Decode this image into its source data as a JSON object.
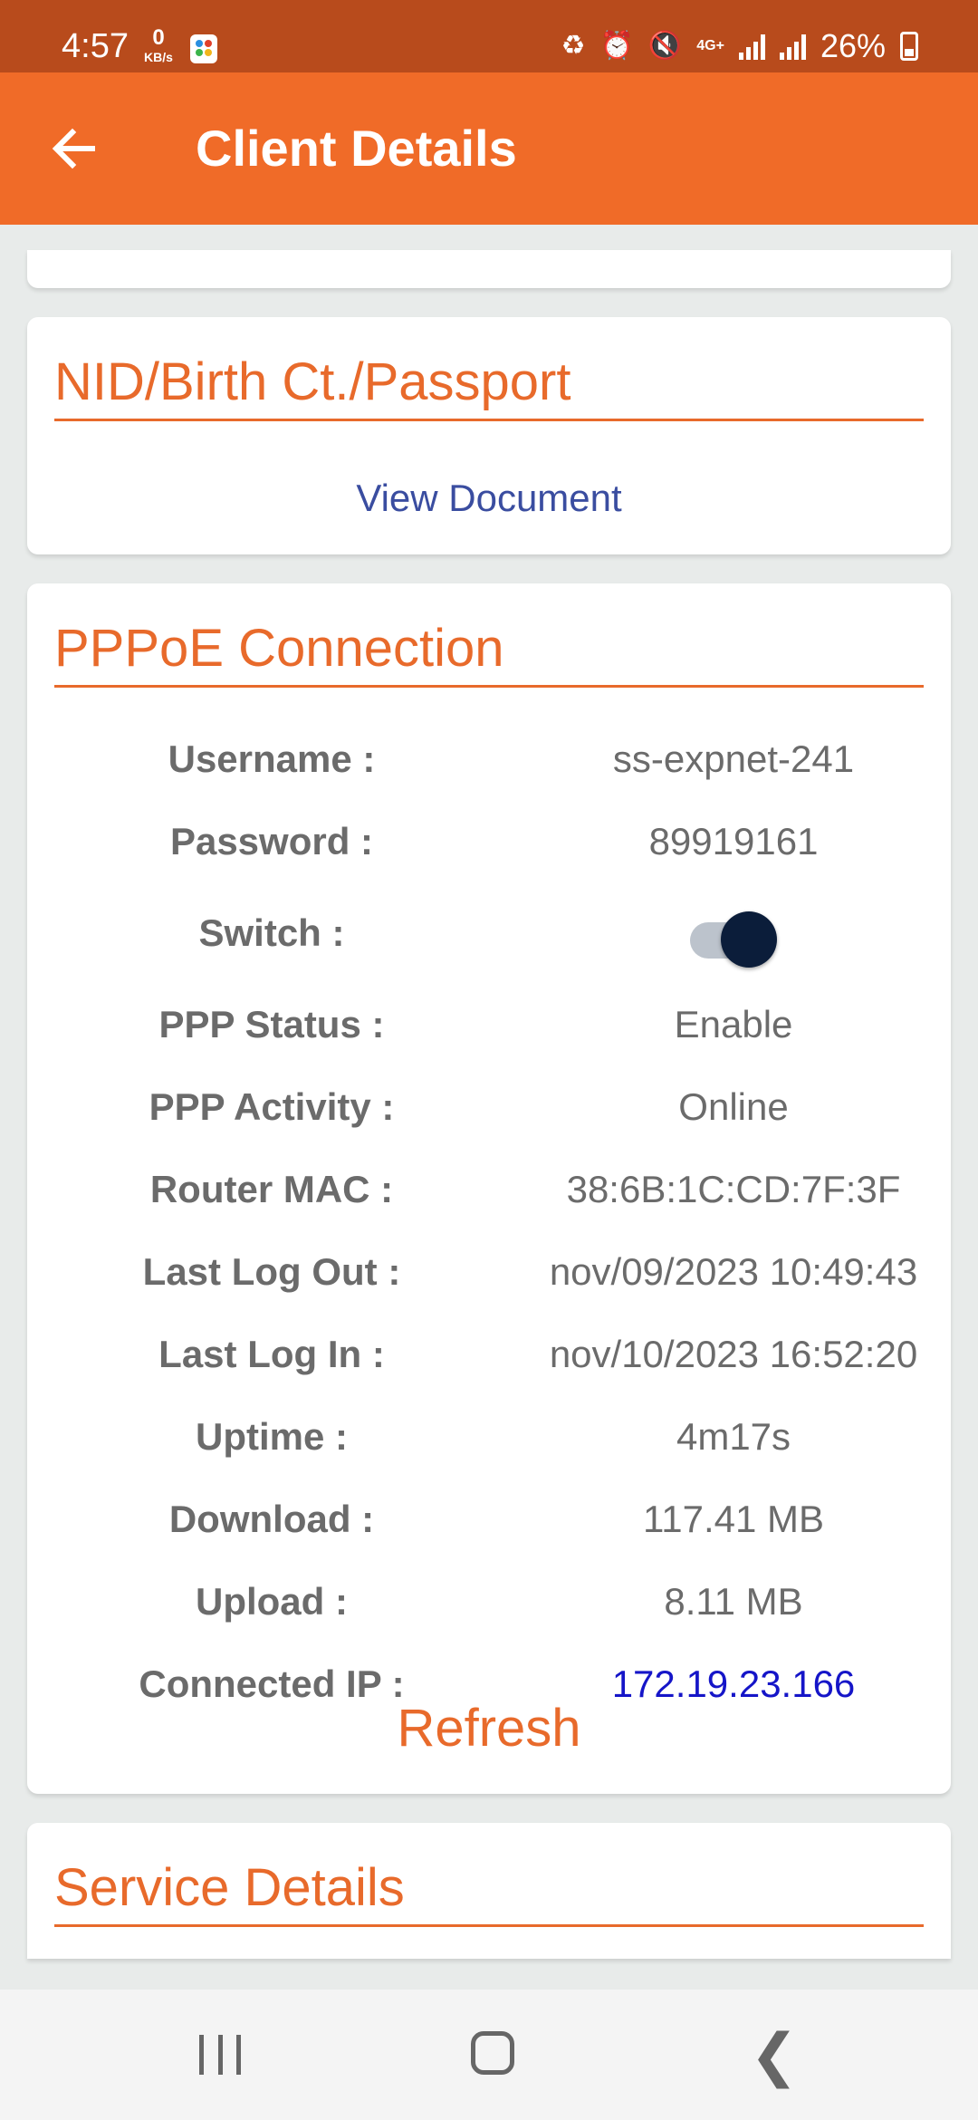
{
  "status_bar": {
    "time": "4:57",
    "net_speed_value": "0",
    "net_speed_unit": "KB/s",
    "network_type": "4G+",
    "battery": "26%"
  },
  "app_bar": {
    "title": "Client Details",
    "back_icon": "arrow-left-icon"
  },
  "nid_section": {
    "heading": "NID/Birth Ct./Passport",
    "link": "View Document"
  },
  "pppoe_section": {
    "heading": "PPPoE Connection",
    "rows": [
      {
        "label": "Username :",
        "value": "ss-expnet-241"
      },
      {
        "label": "Password :",
        "value": "89919161"
      },
      {
        "label": "Switch :",
        "value": "on"
      },
      {
        "label": "PPP Status :",
        "value": "Enable"
      },
      {
        "label": "PPP Activity :",
        "value": "Online"
      },
      {
        "label": "Router MAC :",
        "value": "38:6B:1C:CD:7F:3F"
      },
      {
        "label": "Last Log Out :",
        "value": "nov/09/2023 10:49:43"
      },
      {
        "label": "Last Log In :",
        "value": "nov/10/2023 16:52:20"
      },
      {
        "label": "Uptime :",
        "value": "4m17s"
      },
      {
        "label": "Download :",
        "value": "117.41 MB"
      },
      {
        "label": "Upload :",
        "value": "8.11 MB"
      },
      {
        "label": "Connected IP :",
        "value": "172.19.23.166"
      }
    ],
    "refresh_label": "Refresh"
  },
  "service_section": {
    "heading": "Service Details"
  },
  "colors": {
    "status_bar": "#b84b1c",
    "app_bar": "#f06b28",
    "heading": "#e86a2b",
    "link": "#3a4da0",
    "ip": "#1515c8",
    "toggle_thumb": "#0b1d3a"
  }
}
